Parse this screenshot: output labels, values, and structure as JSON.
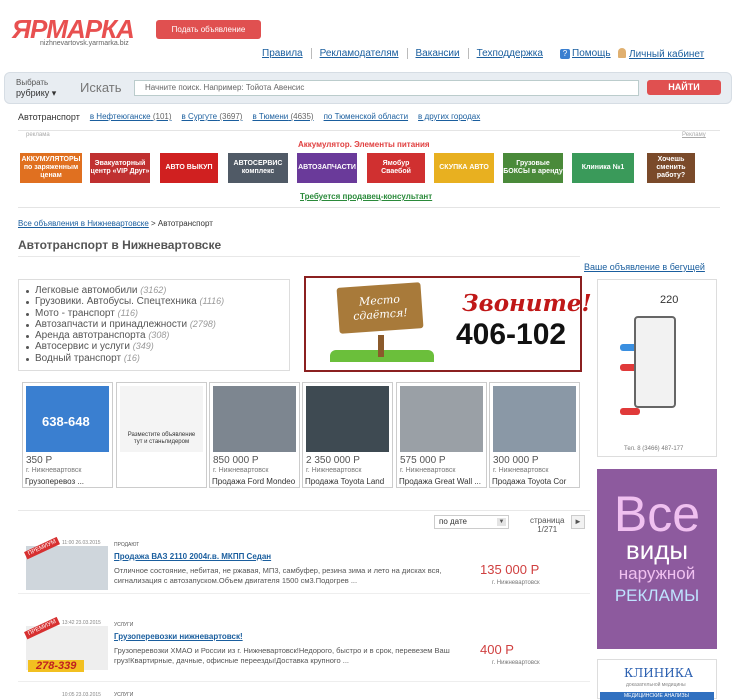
{
  "header": {
    "logo": "ЯРМАРКА",
    "logo_sub": "nizhnevartovsk.yarmarka.biz",
    "post_button": "Подать объявление",
    "links": [
      "Правила",
      "Рекламодателям",
      "Вакансии",
      "Техподдержка"
    ],
    "help": "Помощь",
    "cabinet": "Личный кабинет"
  },
  "search": {
    "rubric_label": "Выбрать",
    "rubric_value": "рубрику",
    "label": "Искать",
    "placeholder": "Начните поиск. Например: Тойота Авенсис",
    "button": "НАЙТИ"
  },
  "regions": {
    "current": "Автотранспорт",
    "items": [
      {
        "label": "в Нефтеюганске",
        "count": "(101)"
      },
      {
        "label": "в Сургуте",
        "count": "(3697)"
      },
      {
        "label": "в Тюмени",
        "count": "(4635)"
      },
      {
        "label": "по Тюменской области",
        "count": ""
      },
      {
        "label": "в других городах",
        "count": ""
      }
    ]
  },
  "ads": {
    "label": "реклама",
    "label_right": "Рекламу",
    "top_text": "Аккумулятор. Элементы питания",
    "bottom_text": "Требуется продавец-консультант",
    "banners": [
      {
        "text": "АККУМУЛЯТОРЫ по заряженным ценам",
        "color": "#e07020"
      },
      {
        "text": "Эвакуаторный центр «VIP Друг»",
        "color": "#c03030"
      },
      {
        "text": "АВТО ВЫКУП",
        "color": "#d02020"
      },
      {
        "text": "АВТОСЕРВИС комплекс",
        "color": "#505a66"
      },
      {
        "text": "АВТОЗАПЧАСТИ",
        "color": "#6a3a9a"
      },
      {
        "text": "Ямобур Сваебой",
        "color": "#d03030"
      },
      {
        "text": "СКУПКА АВТО",
        "color": "#e8b020"
      },
      {
        "text": "Грузовые БОКСЫ в аренду",
        "color": "#4a8a3a"
      },
      {
        "text": "Клиника №1",
        "color": "#3a9a5a"
      },
      {
        "text": "Хочешь сменить работу?",
        "color": "#7a4a2a"
      }
    ]
  },
  "breadcrumb": {
    "link": "Все объявления в Нижневартовске",
    "sep": ">",
    "current": "Автотранспорт"
  },
  "page_title": "Автотранспорт в Нижневартовске",
  "categories": [
    {
      "label": "Легковые автомобили",
      "count": "(3162)"
    },
    {
      "label": "Грузовики. Автобусы. Спецтехника",
      "count": "(1116)"
    },
    {
      "label": "Мото - транспорт",
      "count": "(116)"
    },
    {
      "label": "Автозапчасти и принадлежности",
      "count": "(2798)"
    },
    {
      "label": "Аренда автотранспорта",
      "count": "(308)"
    },
    {
      "label": "Автосервис и услуги",
      "count": "(349)"
    },
    {
      "label": "Водный транспорт",
      "count": "(16)"
    }
  ],
  "main_banner": {
    "sign": "Место сдаётся!",
    "call": "Звоните!",
    "phone": "406-102"
  },
  "run_link": "Ваше объявление в бегущей",
  "right_ads": {
    "ad1_num": "220",
    "ad1_tel": "Тел. 8 (3466) 487-177",
    "ad2_big": "Все",
    "ad2_mid": "виды",
    "ad2_s1": "наружной",
    "ad2_s2": "РЕКЛАМЫ",
    "ad3_title": "КЛИНИКА",
    "ad3_sub": "доказательной медицины",
    "ad3_bar": "МЕДИЦИНСКИЕ АНАЛИЗЫ"
  },
  "thumbs": [
    {
      "price": "350 Р",
      "city": "г. Нижневартовск",
      "name": "Грузоперевоз ...",
      "color": "#3a7fd0",
      "ad_text": "638-648"
    },
    {
      "price": "",
      "city": "",
      "name": "",
      "color": "#f4f4f4",
      "ad_text": "Разместите объявление тут и станьлидером"
    },
    {
      "price": "850 000 Р",
      "city": "г. Нижневартовск",
      "name": "Продажа Ford Mondeo",
      "color": "#7d8690",
      "ad_text": ""
    },
    {
      "price": "2 350 000 Р",
      "city": "г. Нижневартовск",
      "name": "Продажа Toyota Land",
      "color": "#3e4a52",
      "ad_text": ""
    },
    {
      "price": "575 000 Р",
      "city": "г. Нижневартовск",
      "name": "Продажа Great Wall ...",
      "color": "#9aa0a6",
      "ad_text": ""
    },
    {
      "price": "300 000 Р",
      "city": "г. Нижневартовск",
      "name": "Продажа Toyota Cor",
      "color": "#8a98a6",
      "ad_text": ""
    }
  ],
  "sort": {
    "value": "по дате",
    "page_label": "страница",
    "page_value": "1/271",
    "next": "►"
  },
  "listings": [
    {
      "ribbon": "ПРЕМИУМ",
      "date": "11:00 26.03.2015",
      "category": "ПРОДАЮТ",
      "title": "Продажа ВАЗ 2110 2004г.в. МКПП Седан",
      "desc": "Отличное состояние, небитая, не ржавая, МП3, самбуфер, резина зима и лето на дисках вся, сигнализация с автозапуском.Объем двигателя 1500 см3.Подогрев ...",
      "price": "135 000 Р",
      "city": "г. Нижневартовск"
    },
    {
      "ribbon": "ПРЕМИУМ",
      "date": "13:42 23.03.2015",
      "category": "УСЛУГИ",
      "title": "Грузоперевозки нижневартовск!",
      "desc": "Грузоперевозки ХМАО и России из г. Нижневартовск!Недорого, быстро и в срок, перевезем Ваш груз!Квартирные, дачные, офисные переезды!Доставка крупного ...",
      "price": "400 Р",
      "city": "г. Нижневартовск",
      "phone": "278-339"
    },
    {
      "date": "10:05 23.03.2015",
      "category": "УСЛУГИ"
    }
  ]
}
